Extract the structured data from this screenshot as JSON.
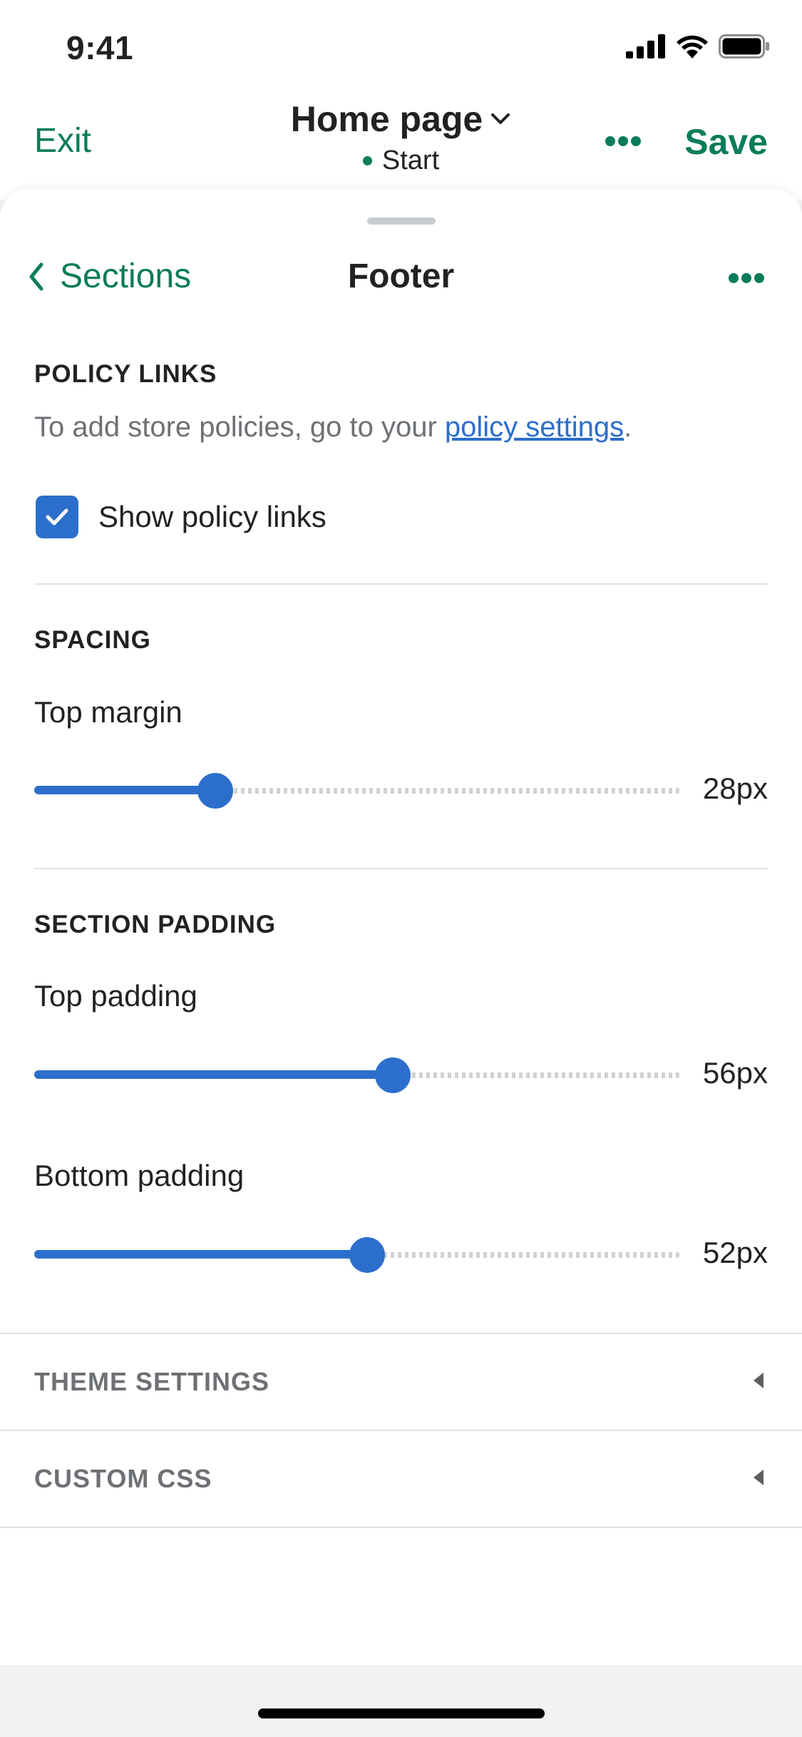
{
  "status_bar": {
    "time": "9:41"
  },
  "header": {
    "exit_label": "Exit",
    "page_title": "Home page",
    "page_subtitle": "Start",
    "save_label": "Save"
  },
  "nav": {
    "back_label": "Sections",
    "title": "Footer"
  },
  "policy": {
    "heading": "POLICY LINKS",
    "helper_prefix": "To add store policies, go to your ",
    "helper_link": "policy settings",
    "helper_suffix": ".",
    "checkbox_label": "Show policy links",
    "checked": true
  },
  "spacing": {
    "heading": "SPACING",
    "top_margin_label": "Top margin",
    "top_margin_value": "28px",
    "top_margin_fraction": 0.28
  },
  "padding": {
    "heading": "SECTION PADDING",
    "top_label": "Top padding",
    "top_value": "56px",
    "top_fraction": 0.555,
    "bottom_label": "Bottom padding",
    "bottom_value": "52px",
    "bottom_fraction": 0.515
  },
  "collapsibles": [
    {
      "label": "THEME SETTINGS"
    },
    {
      "label": "CUSTOM CSS"
    }
  ],
  "colors": {
    "brand_green": "#0a7c5a",
    "accent_blue": "#2c6ecb"
  }
}
